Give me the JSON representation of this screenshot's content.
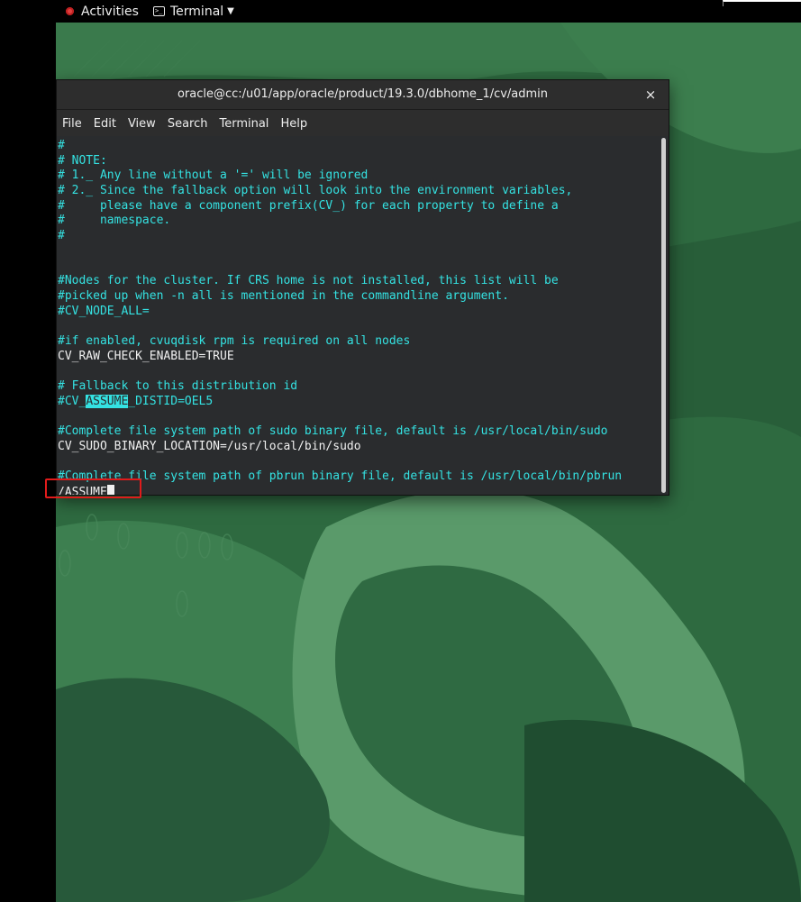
{
  "topbar": {
    "activities": "Activities",
    "app_name": "Terminal",
    "app_icon": "terminal-icon",
    "menu_icon": "chevron-down-icon"
  },
  "window": {
    "title": "oracle@cc:/u01/app/oracle/product/19.3.0/dbhome_1/cv/admin",
    "close_label": "×",
    "menu": [
      "File",
      "Edit",
      "View",
      "Search",
      "Terminal",
      "Help"
    ]
  },
  "colors": {
    "comment": "#34e2e2",
    "text": "#f0f0f0",
    "highlight": "#34e2e2",
    "annotation_box": "#e01b1b"
  },
  "terminal": {
    "lines": [
      {
        "type": "c",
        "text": "#"
      },
      {
        "type": "c",
        "text": "# NOTE:"
      },
      {
        "type": "c",
        "text": "# 1._ Any line without a '=' will be ignored"
      },
      {
        "type": "c",
        "text": "# 2._ Since the fallback option will look into the environment variables,"
      },
      {
        "type": "c",
        "text": "#     please have a component prefix(CV_) for each property to define a"
      },
      {
        "type": "c",
        "text": "#     namespace."
      },
      {
        "type": "c",
        "text": "#"
      },
      {
        "type": "b",
        "text": ""
      },
      {
        "type": "b",
        "text": ""
      },
      {
        "type": "c",
        "text": "#Nodes for the cluster. If CRS home is not installed, this list will be"
      },
      {
        "type": "c",
        "text": "#picked up when -n all is mentioned in the commandline argument."
      },
      {
        "type": "c",
        "text": "#CV_NODE_ALL="
      },
      {
        "type": "b",
        "text": ""
      },
      {
        "type": "c",
        "text": "#if enabled, cvuqdisk rpm is required on all nodes"
      },
      {
        "type": "w",
        "text": "CV_RAW_CHECK_ENABLED=TRUE"
      },
      {
        "type": "b",
        "text": ""
      },
      {
        "type": "c",
        "text": "# Fallback to this distribution id"
      },
      {
        "type": "h",
        "before": "#CV_",
        "match": "ASSUME",
        "after": "_DISTID=OEL5"
      },
      {
        "type": "b",
        "text": ""
      },
      {
        "type": "c",
        "text": "#Complete file system path of sudo binary file, default is /usr/local/bin/sudo"
      },
      {
        "type": "w",
        "text": "CV_SUDO_BINARY_LOCATION=/usr/local/bin/sudo"
      },
      {
        "type": "b",
        "text": ""
      },
      {
        "type": "c",
        "text": "#Complete file system path of pbrun binary file, default is /usr/local/bin/pbrun"
      }
    ],
    "prompt": "/ASSUME"
  }
}
